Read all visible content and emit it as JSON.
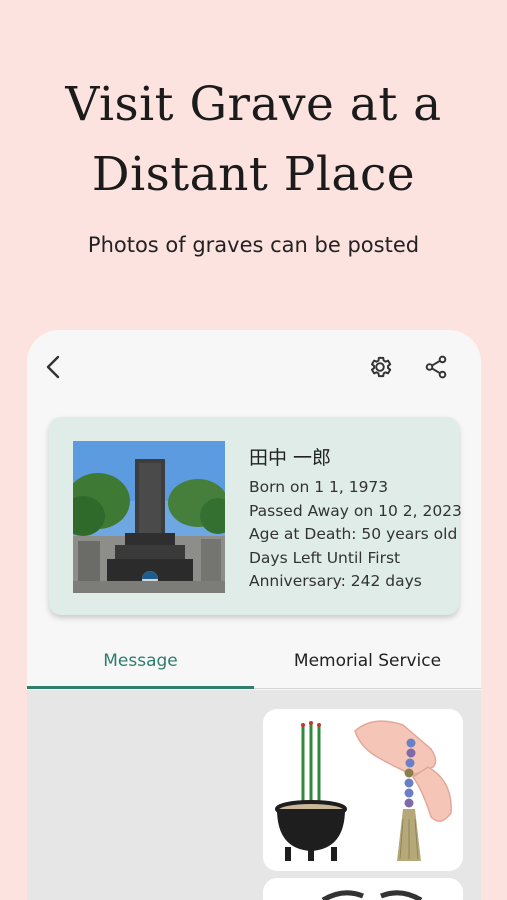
{
  "promo": {
    "headline_line1": "Visit Grave at a",
    "headline_line2": "Distant Place",
    "subtitle": "Photos of graves can be posted"
  },
  "toolbar": {
    "back_icon": "chevron-left-icon",
    "settings_icon": "gear-icon",
    "share_icon": "share-icon"
  },
  "profile": {
    "name": "田中 一郎",
    "born": "Born on 1 1, 1973",
    "passed": "Passed Away on 10 2, 2023",
    "age": "Age at Death: 50 years old",
    "days_left_line1": "Days Left Until First",
    "days_left_line2": "Anniversary: 242 days"
  },
  "tabs": [
    {
      "label": "Message",
      "active": true
    },
    {
      "label": "Memorial Service",
      "active": false
    }
  ],
  "colors": {
    "background": "#fde3df",
    "accent": "#2e7d6d",
    "card": "#dfece8"
  }
}
